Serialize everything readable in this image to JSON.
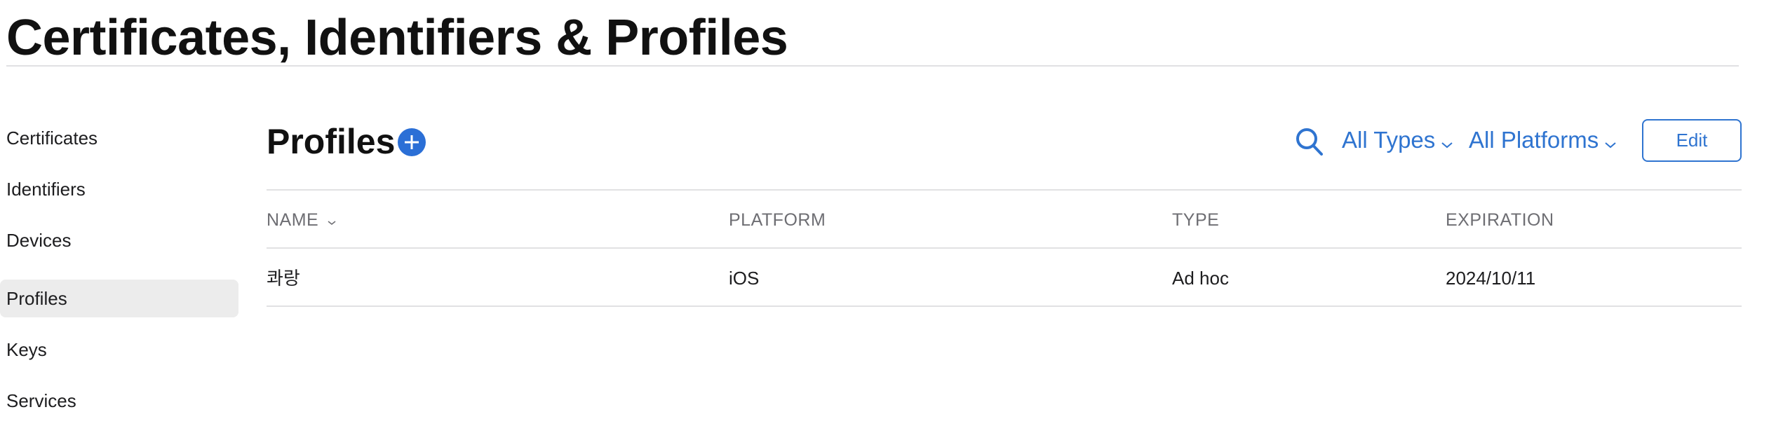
{
  "page": {
    "title": "Certificates, Identifiers & Profiles"
  },
  "sidebar": {
    "items": [
      {
        "label": "Certificates"
      },
      {
        "label": "Identifiers"
      },
      {
        "label": "Devices"
      },
      {
        "label": "Profiles",
        "active": true
      },
      {
        "label": "Keys"
      },
      {
        "label": "Services"
      }
    ]
  },
  "main": {
    "title": "Profiles",
    "add_icon": "plus-circle-icon",
    "search_icon": "search-icon",
    "filters": {
      "type": "All Types",
      "platform": "All Platforms"
    },
    "edit_label": "Edit",
    "table": {
      "columns": [
        "NAME",
        "PLATFORM",
        "TYPE",
        "EXPIRATION"
      ],
      "sort_icon": "chevron-down-icon",
      "rows": [
        {
          "name": "콰랑",
          "platform": "iOS",
          "type": "Ad hoc",
          "expiration": "2024/10/11"
        }
      ]
    }
  },
  "colors": {
    "accent": "#2f74d0",
    "add_button": "#2b6fd6",
    "active_item_bg": "#ececec",
    "divider": "#e1e1e3"
  }
}
